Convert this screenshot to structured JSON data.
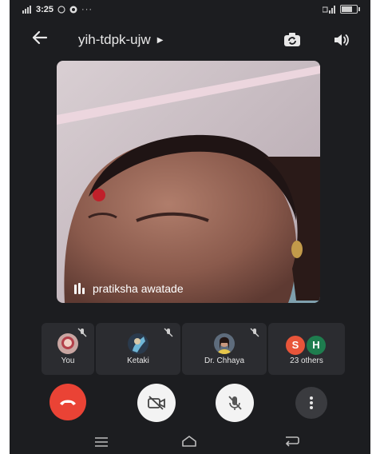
{
  "status_bar": {
    "time": "3:25"
  },
  "header": {
    "meeting_code": "yih-tdpk-ujw"
  },
  "main_video": {
    "speaker_name": "pratiksha awatade"
  },
  "participants": [
    {
      "label": "You"
    },
    {
      "label": "Ketaki"
    },
    {
      "label": "Dr. Chhaya"
    },
    {
      "label": "23 others",
      "avatars": [
        "S",
        "H"
      ]
    }
  ],
  "colors": {
    "end_call": "#ea4335",
    "letter_s": "#e8553a",
    "letter_h": "#1e7d4e",
    "background": "#1c1d20",
    "tile": "#2b2c30"
  }
}
